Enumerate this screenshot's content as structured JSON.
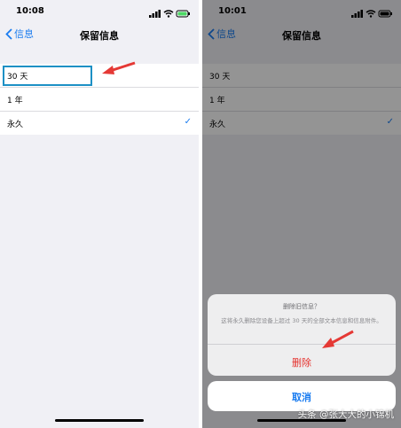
{
  "left": {
    "status_time": "10:08",
    "nav": {
      "back_label": "信息",
      "title": "保留信息"
    },
    "options": [
      {
        "label": "30 天",
        "checked": false
      },
      {
        "label": "1 年",
        "checked": false
      },
      {
        "label": "永久",
        "checked": true
      }
    ],
    "check_symbol": "✓"
  },
  "right": {
    "status_time": "10:01",
    "nav": {
      "back_label": "信息",
      "title": "保留信息"
    },
    "options": [
      {
        "label": "30 天",
        "checked": false
      },
      {
        "label": "1 年",
        "checked": false
      },
      {
        "label": "永久",
        "checked": true
      }
    ],
    "check_symbol": "✓",
    "action_sheet": {
      "title": "删除旧信息？",
      "message": "这将永久删除您设备上超过 30 天的全部文本信息和信息附件。",
      "delete_label": "删除",
      "cancel_label": "取消"
    }
  },
  "watermark": "头条 @张大大的小锦机",
  "colors": {
    "accent": "#1a7cf0",
    "destructive": "#e5312d",
    "annotation_red": "#e53935",
    "highlight_box": "#1d90c5"
  },
  "icons": [
    "chevron-left-icon",
    "signal-icon",
    "wifi-icon",
    "battery-icon",
    "checkmark-icon",
    "annotation-arrow-icon"
  ]
}
